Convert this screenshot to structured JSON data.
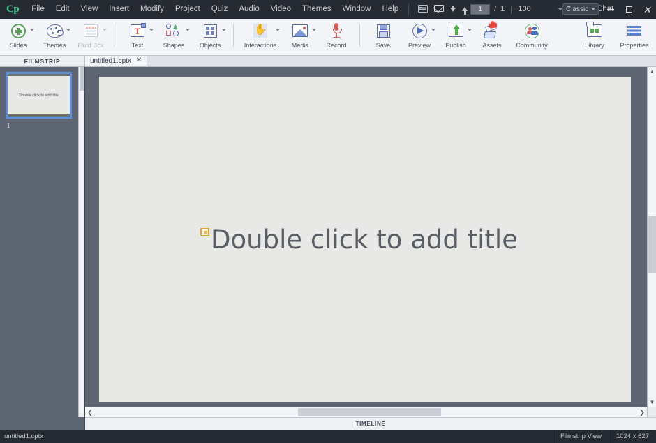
{
  "app": {
    "logo": "Cp",
    "title": "untitled1.cptx"
  },
  "menubar": {
    "items": [
      {
        "label": "File"
      },
      {
        "label": "Edit"
      },
      {
        "label": "View"
      },
      {
        "label": "Insert"
      },
      {
        "label": "Modify"
      },
      {
        "label": "Project"
      },
      {
        "label": "Quiz"
      },
      {
        "label": "Audio"
      },
      {
        "label": "Video"
      },
      {
        "label": "Themes"
      },
      {
        "label": "Window"
      },
      {
        "label": "Help"
      }
    ],
    "icons": [
      {
        "name": "card-view-icon"
      },
      {
        "name": "mail-icon"
      },
      {
        "name": "move-down-icon"
      },
      {
        "name": "move-up-icon"
      }
    ],
    "page_current": "1",
    "page_separator": "/",
    "page_total": "1",
    "divider": "|",
    "zoom_value": "100",
    "live_chat": "Live Chat",
    "workspace": "Classic",
    "window": {
      "minimize": "minimize-button",
      "maximize": "maximize-button",
      "close": "✕"
    }
  },
  "toolbar": {
    "groups": [
      {
        "items": [
          {
            "label": "Slides",
            "icon": "add-slide-icon",
            "caret": true,
            "disabled": false
          },
          {
            "label": "Themes",
            "icon": "palette-icon",
            "caret": true,
            "disabled": false
          },
          {
            "label": "Fluid Box",
            "icon": "fluid-box-icon",
            "caret": true,
            "disabled": true
          }
        ]
      },
      {
        "items": [
          {
            "label": "Text",
            "icon": "text-icon",
            "caret": true,
            "disabled": false
          },
          {
            "label": "Shapes",
            "icon": "shapes-icon",
            "caret": true,
            "disabled": false
          },
          {
            "label": "Objects",
            "icon": "objects-icon",
            "caret": true,
            "disabled": false
          }
        ]
      },
      {
        "items": [
          {
            "label": "Interactions",
            "icon": "hand-pointer-icon",
            "caret": true,
            "disabled": false
          },
          {
            "label": "Media",
            "icon": "media-image-icon",
            "caret": true,
            "disabled": false
          },
          {
            "label": "Record",
            "icon": "microphone-icon",
            "caret": false,
            "disabled": false
          }
        ]
      },
      {
        "items": [
          {
            "label": "Save",
            "icon": "save-disk-icon",
            "caret": false,
            "disabled": false
          },
          {
            "label": "Preview",
            "icon": "preview-play-icon",
            "caret": true,
            "disabled": false
          },
          {
            "label": "Publish",
            "icon": "publish-upload-icon",
            "caret": true,
            "disabled": false
          },
          {
            "label": "Assets",
            "icon": "assets-box-icon",
            "caret": false,
            "disabled": false
          },
          {
            "label": "Community",
            "icon": "community-people-icon",
            "caret": false,
            "disabled": false
          }
        ]
      },
      {
        "items": [
          {
            "label": "Library",
            "icon": "library-folder-icon",
            "caret": false,
            "disabled": false
          },
          {
            "label": "Properties",
            "icon": "properties-lines-icon",
            "caret": false,
            "disabled": false
          }
        ]
      }
    ]
  },
  "filmstrip": {
    "header": "FILMSTRIP",
    "slides": [
      {
        "number": "1",
        "thumb_text": "Double click to add title"
      }
    ]
  },
  "tabs": [
    {
      "label": "untitled1.cptx",
      "close": "✕",
      "active": true
    }
  ],
  "canvas": {
    "title_placeholder": "Double click to add title",
    "fluid_marker": "fluid-box-marker-icon"
  },
  "timeline": {
    "header": "TIMELINE"
  },
  "statusbar": {
    "filename": "untitled1.cptx",
    "view_mode": "Filmstrip View",
    "dimensions": "1024 x 627"
  },
  "scroll": {
    "up_arrow": "▲",
    "down_arrow": "▼",
    "left_arrow": "❮",
    "right_arrow": "❯"
  },
  "colors": {
    "accent_green": "#3ecf8e",
    "selection_blue": "#5c8fe0",
    "dark_chrome": "#262b33",
    "panel_gray": "#5d6472",
    "slide_bg": "#e8e8e6"
  }
}
